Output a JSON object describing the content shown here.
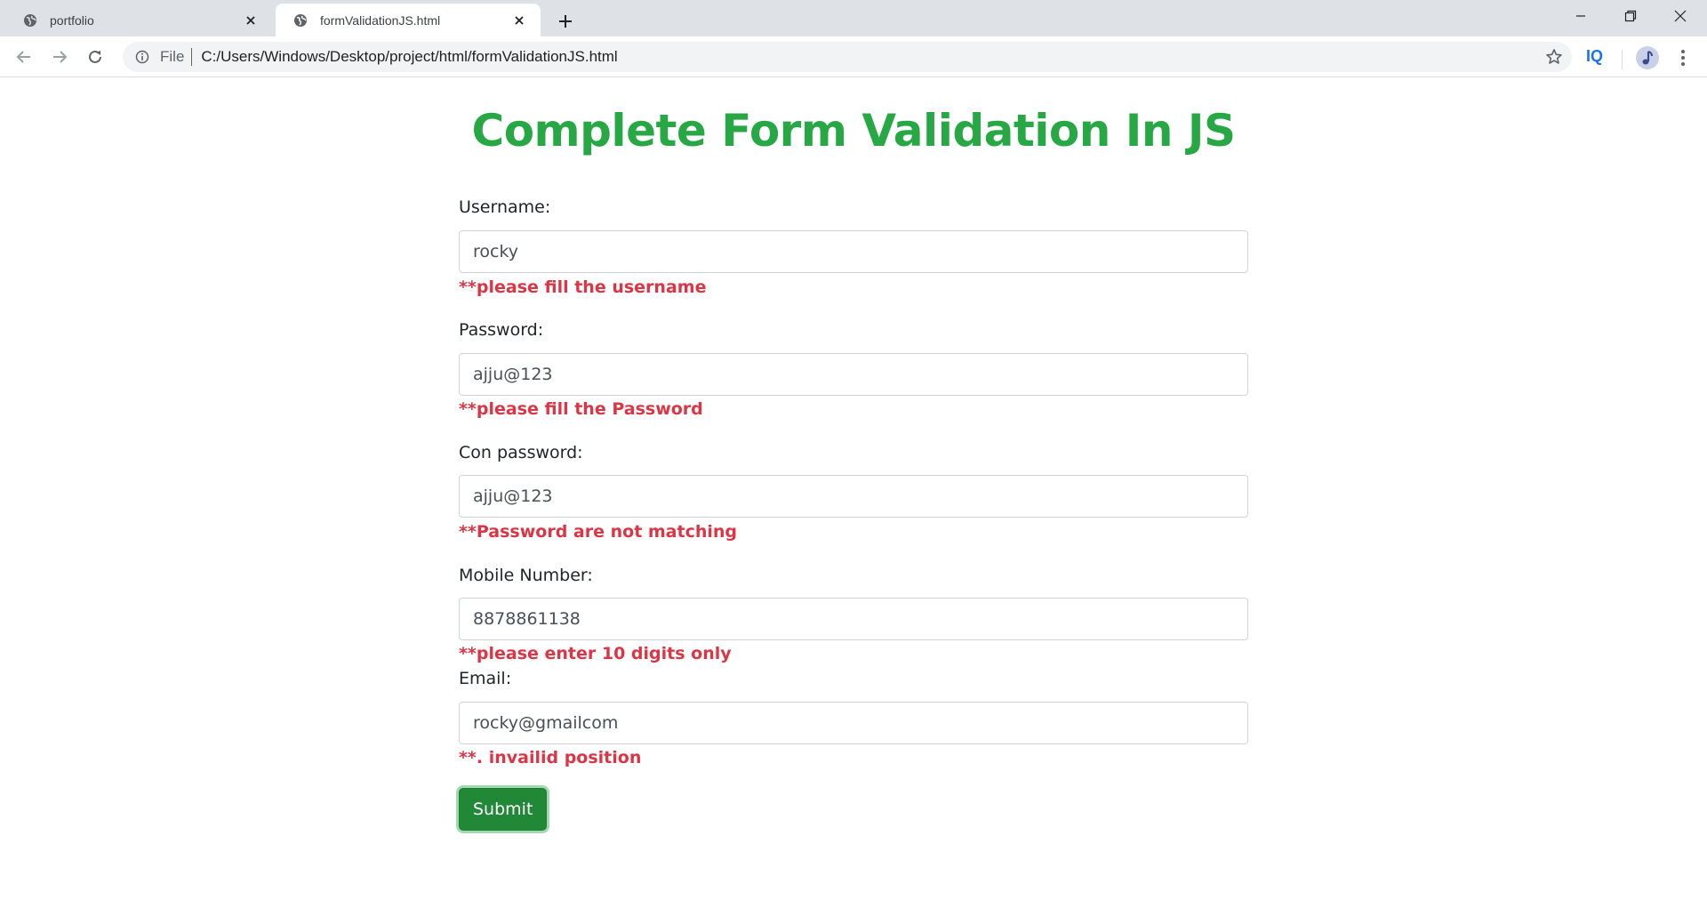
{
  "browser": {
    "tabs": [
      {
        "title": "portfolio"
      },
      {
        "title": "formValidationJS.html"
      }
    ],
    "address": {
      "scheme_label": "File",
      "url": "C:/Users/Windows/Desktop/project/html/formValidationJS.html"
    },
    "extension_label": "IQ"
  },
  "page": {
    "heading": "Complete Form Validation In JS",
    "fields": {
      "username": {
        "label": "Username:",
        "value": "rocky",
        "error": "**please fill the username"
      },
      "password": {
        "label": "Password:",
        "value": "ajju@123",
        "error": "**please fill the Password"
      },
      "confirm": {
        "label": "Con password:",
        "value": "ajju@123",
        "error": "**Password are not matching"
      },
      "mobile": {
        "label": "Mobile Number:",
        "value": "8878861138",
        "error": "**please enter 10 digits only"
      },
      "email": {
        "label": "Email:",
        "value": "rocky@gmailcom",
        "error": "**. invailid position"
      }
    },
    "submit_label": "Submit"
  },
  "colors": {
    "heading": "#28a745",
    "error": "#dc3545",
    "submit": "#218838"
  }
}
